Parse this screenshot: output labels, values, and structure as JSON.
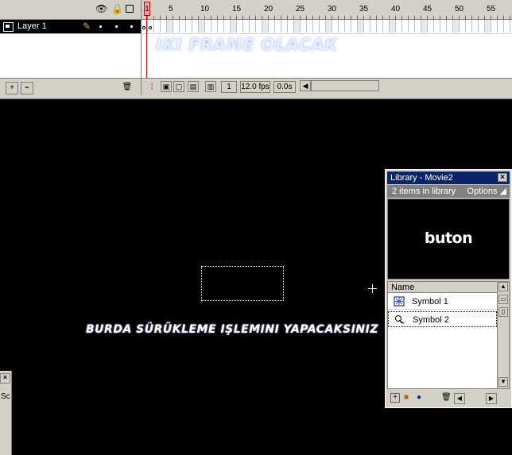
{
  "timeline": {
    "layer_name": "Layer 1",
    "header_icons": [
      "eye-icon",
      "lock-icon",
      "outline-icon"
    ],
    "frame_numbers": [
      "1",
      "5",
      "10",
      "15",
      "20",
      "25",
      "30",
      "35",
      "40",
      "45",
      "50",
      "55"
    ],
    "current_frame": "1",
    "frame_rate": "12.0 fps",
    "elapsed_time": "0.0s",
    "overlay_text": "IKI FRAME OLACAK"
  },
  "stage": {
    "instruction_text": "BURDA SÜRÜKLEME IŞLEMINI YAPACAKSINIZ"
  },
  "library": {
    "title": "Library - Movie2",
    "count_text": "2 items in library",
    "options_label": "Options",
    "preview_text": "buton",
    "column_name": "Name",
    "items": [
      {
        "label": "Symbol 1",
        "icon": "button-symbol-icon"
      },
      {
        "label": "Symbol 2",
        "icon": "graphic-symbol-icon"
      }
    ]
  },
  "left_panel": {
    "partial_text": "Sc"
  },
  "colors": {
    "panel_bg": "#d4d0c8",
    "title_bar": "#0a246a",
    "stage_bg": "#000000",
    "playhead": "#e00000"
  }
}
